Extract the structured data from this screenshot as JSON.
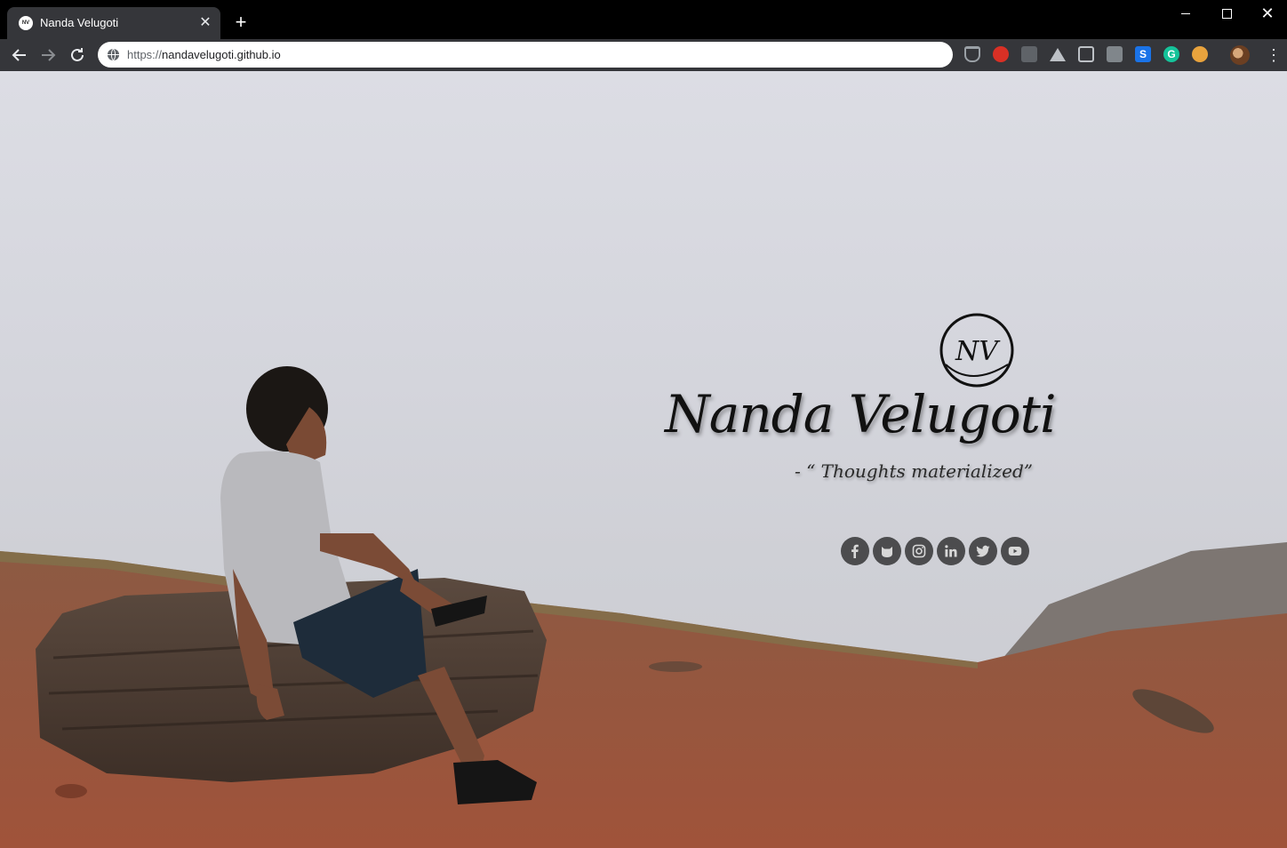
{
  "browser": {
    "tab": {
      "title": "Nanda Velugoti",
      "favicon_text": "NV"
    },
    "address_bar": {
      "scheme": "https://",
      "host": "nandavelugoti.github.io"
    },
    "extensions": [
      "pocket-icon",
      "adblock-icon",
      "lightbulb-icon",
      "drive-icon",
      "reader-icon",
      "terminal-icon",
      "s-icon",
      "grammarly-icon",
      "owl-icon"
    ],
    "extension_labels": {
      "s": "S",
      "grammarly": "G"
    }
  },
  "hero": {
    "logo_text": "NV",
    "name": "Nanda Velugoti",
    "tagline": "- “ Thoughts materialized”"
  },
  "social": [
    {
      "id": "facebook",
      "icon": "facebook-icon"
    },
    {
      "id": "github",
      "icon": "github-icon"
    },
    {
      "id": "instagram",
      "icon": "instagram-icon"
    },
    {
      "id": "linkedin",
      "icon": "linkedin-icon"
    },
    {
      "id": "twitter",
      "icon": "twitter-icon"
    },
    {
      "id": "youtube",
      "icon": "youtube-icon"
    }
  ],
  "colors": {
    "chrome_bg": "#000000",
    "toolbar_bg": "#35363a",
    "sky": "#d6d7de",
    "ground": "#9a5a3c",
    "social_button": "#4c4c4e"
  }
}
